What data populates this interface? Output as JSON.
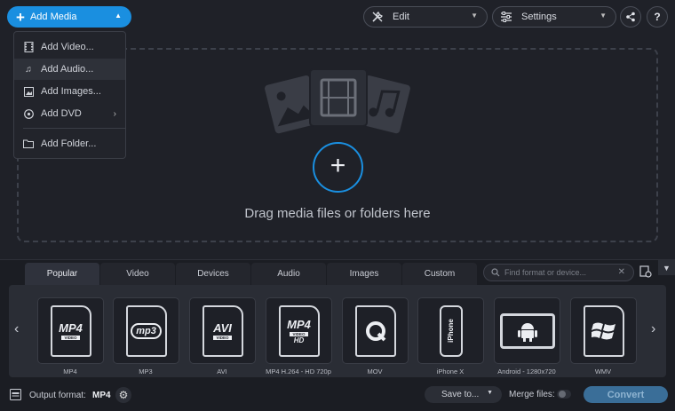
{
  "toolbar": {
    "add_media_label": "Add Media",
    "edit_label": "Edit",
    "settings_label": "Settings",
    "help_label": "?"
  },
  "add_menu": {
    "items": [
      {
        "label": "Add Video...",
        "icon": "film-icon"
      },
      {
        "label": "Add Audio...",
        "icon": "music-note-icon",
        "highlighted": true
      },
      {
        "label": "Add Images...",
        "icon": "image-icon"
      },
      {
        "label": "Add DVD",
        "icon": "disc-icon",
        "has_submenu": true
      },
      {
        "label": "Add Folder...",
        "icon": "folder-icon"
      }
    ]
  },
  "dropzone": {
    "text": "Drag media files or folders here"
  },
  "tabs": [
    {
      "label": "Popular",
      "active": true
    },
    {
      "label": "Video"
    },
    {
      "label": "Devices"
    },
    {
      "label": "Audio"
    },
    {
      "label": "Images"
    },
    {
      "label": "Custom"
    }
  ],
  "search": {
    "placeholder": "Find format or device..."
  },
  "formats": [
    {
      "label": "MP4",
      "icon_text": "MP4",
      "band": "VIDEO"
    },
    {
      "label": "MP3",
      "icon_text": "mp3"
    },
    {
      "label": "AVI",
      "icon_text": "AVI",
      "band": "VIDEO"
    },
    {
      "label": "MP4 H.264 - HD 720p",
      "icon_text": "MP4",
      "band": "VIDEO",
      "sub": "HD"
    },
    {
      "label": "MOV",
      "icon": "quicktime-icon"
    },
    {
      "label": "iPhone X",
      "icon_text": "iPhone"
    },
    {
      "label": "Android - 1280x720",
      "icon": "android-icon"
    },
    {
      "label": "WMV",
      "icon": "windows-icon"
    }
  ],
  "footer": {
    "output_format_label": "Output format:",
    "output_format_value": "MP4",
    "save_label": "Save to...",
    "merge_label": "Merge files:",
    "convert_label": "Convert"
  },
  "colors": {
    "accent": "#1a8fe0",
    "background": "#1f2128",
    "convert_disabled": "#3a6e98"
  }
}
